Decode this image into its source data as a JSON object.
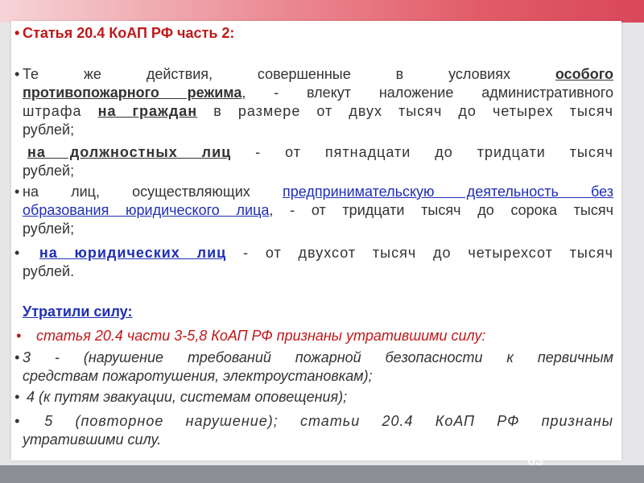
{
  "title": "Статья 20.4 КоАП РФ часть 2:",
  "para1": {
    "l1_text": "Те же действия, совершенные в условиях",
    "l1_link": "особого",
    "l2_link": "противопожарного режима",
    "l2_text": ", - влекут наложение административного",
    "l3_a": "штрафа",
    "l3_link": "на граждан",
    "l3_b": "в размере от двух тысяч до четырех тысяч",
    "l4": "рублей;"
  },
  "para2": {
    "link": "на должностных лиц",
    "text": "- от пятнадцати до тридцати тысяч",
    "l2": "рублей;"
  },
  "para3": {
    "a": "на лиц, осуществляющих",
    "link1": "предпринимательскую деятельность без",
    "link2": "образования юридического лица",
    "b": ", - от тридцати тысяч до сорока тысяч",
    "l3": "рублей;"
  },
  "para4": {
    "link": "на юридических лиц",
    "text": "- от двухсот тысяч до четырехсот тысяч",
    "l2": "рублей."
  },
  "repealed_heading": "Утратили силу:",
  "repealed_list": [
    "статья 20.4 части 3-5,8 КоАП РФ признаны утратившими силу:",
    "3 - (нарушение требований пожарной безопасности к первичным",
    "средствам пожаротушения, электроустановкам);",
    "4 (к путям эвакуации, системам оповещения);",
    "5 (повторное нарушение); статьи 20.4 КоАП РФ признаны",
    "утратившими силу."
  ],
  "slide_number": "63",
  "colors": {
    "accent_red": "#c0181a",
    "link_blue": "#1f2fb5",
    "text": "#333333"
  }
}
